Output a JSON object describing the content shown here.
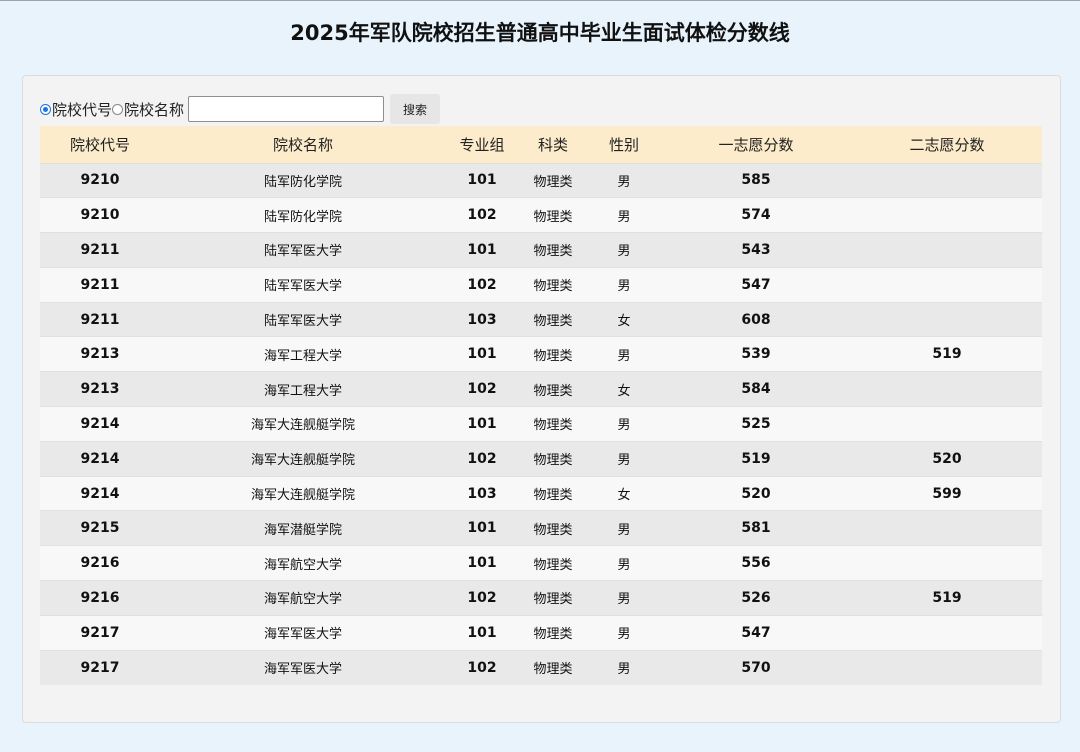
{
  "page_title": "2025年军队院校招生普通高中毕业生面试体检分数线",
  "search": {
    "option_code": "院校代号",
    "option_name": "院校名称",
    "input_value": "",
    "button": "搜索"
  },
  "table": {
    "headers": [
      "院校代号",
      "院校名称",
      "专业组",
      "科类",
      "性别",
      "一志愿分数",
      "二志愿分数"
    ],
    "rows": [
      {
        "code": "9210",
        "name": "陆军防化学院",
        "group": "101",
        "type": "物理类",
        "gender": "男",
        "score1": "585",
        "score2": ""
      },
      {
        "code": "9210",
        "name": "陆军防化学院",
        "group": "102",
        "type": "物理类",
        "gender": "男",
        "score1": "574",
        "score2": ""
      },
      {
        "code": "9211",
        "name": "陆军军医大学",
        "group": "101",
        "type": "物理类",
        "gender": "男",
        "score1": "543",
        "score2": ""
      },
      {
        "code": "9211",
        "name": "陆军军医大学",
        "group": "102",
        "type": "物理类",
        "gender": "男",
        "score1": "547",
        "score2": ""
      },
      {
        "code": "9211",
        "name": "陆军军医大学",
        "group": "103",
        "type": "物理类",
        "gender": "女",
        "score1": "608",
        "score2": ""
      },
      {
        "code": "9213",
        "name": "海军工程大学",
        "group": "101",
        "type": "物理类",
        "gender": "男",
        "score1": "539",
        "score2": "519"
      },
      {
        "code": "9213",
        "name": "海军工程大学",
        "group": "102",
        "type": "物理类",
        "gender": "女",
        "score1": "584",
        "score2": ""
      },
      {
        "code": "9214",
        "name": "海军大连舰艇学院",
        "group": "101",
        "type": "物理类",
        "gender": "男",
        "score1": "525",
        "score2": ""
      },
      {
        "code": "9214",
        "name": "海军大连舰艇学院",
        "group": "102",
        "type": "物理类",
        "gender": "男",
        "score1": "519",
        "score2": "520"
      },
      {
        "code": "9214",
        "name": "海军大连舰艇学院",
        "group": "103",
        "type": "物理类",
        "gender": "女",
        "score1": "520",
        "score2": "599"
      },
      {
        "code": "9215",
        "name": "海军潜艇学院",
        "group": "101",
        "type": "物理类",
        "gender": "男",
        "score1": "581",
        "score2": ""
      },
      {
        "code": "9216",
        "name": "海军航空大学",
        "group": "101",
        "type": "物理类",
        "gender": "男",
        "score1": "556",
        "score2": ""
      },
      {
        "code": "9216",
        "name": "海军航空大学",
        "group": "102",
        "type": "物理类",
        "gender": "男",
        "score1": "526",
        "score2": "519"
      },
      {
        "code": "9217",
        "name": "海军军医大学",
        "group": "101",
        "type": "物理类",
        "gender": "男",
        "score1": "547",
        "score2": ""
      },
      {
        "code": "9217",
        "name": "海军军医大学",
        "group": "102",
        "type": "物理类",
        "gender": "男",
        "score1": "570",
        "score2": ""
      }
    ]
  }
}
